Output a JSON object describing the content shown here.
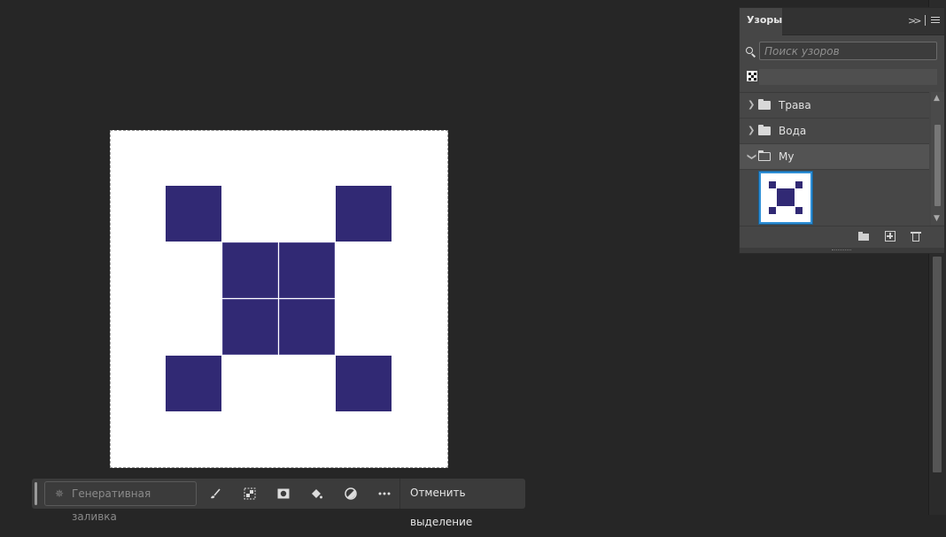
{
  "canvas": {
    "background": "#ffffff",
    "pattern_color": "#312974"
  },
  "patterns_panel": {
    "tab_label": "Узоры",
    "search_placeholder": "Поиск узоров",
    "groups": [
      {
        "label": "Трава",
        "expanded": false
      },
      {
        "label": "Вода",
        "expanded": false
      },
      {
        "label": "My",
        "expanded": true
      }
    ],
    "selected_pattern_color": "#312974",
    "selection_color": "#2d8ed6"
  },
  "taskbar": {
    "generative_fill_label": "Генеративная заливка",
    "deselect_label": "Отменить выделение"
  },
  "icons": [
    "search-icon",
    "collapse-icon",
    "panel-menu-icon",
    "folder-icon",
    "new-group-icon",
    "new-pattern-icon",
    "trash-icon",
    "brush-icon",
    "mask-icon",
    "fill-icon",
    "adjustment-icon",
    "more-icon"
  ]
}
